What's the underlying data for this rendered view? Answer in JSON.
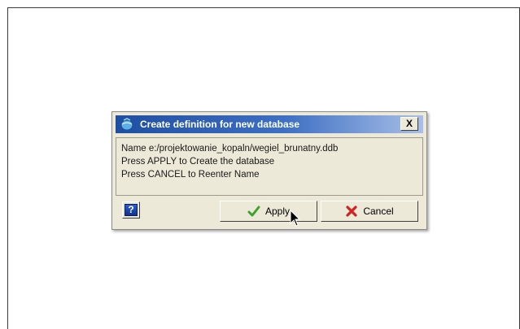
{
  "dialog": {
    "title": "Create definition for new database",
    "close_label": "X",
    "message_lines": [
      "Name  e:/projektowanie_kopaln/wegiel_brunatny.ddb",
      "Press APPLY to Create the database",
      "Press CANCEL to Reenter Name"
    ],
    "help_label": "?",
    "apply_label": "Apply",
    "cancel_label": "Cancel"
  },
  "colors": {
    "titlebar_start": "#1f4fa3",
    "titlebar_end": "#a9bfe6",
    "dialog_bg": "#ece9d8",
    "apply_check": "#3fa22a",
    "cancel_x": "#d42020"
  },
  "icons": {
    "title": "database-globe-icon",
    "help": "help-icon",
    "apply": "checkmark-icon",
    "cancel": "red-x-icon",
    "cursor": "mouse-pointer-icon"
  }
}
